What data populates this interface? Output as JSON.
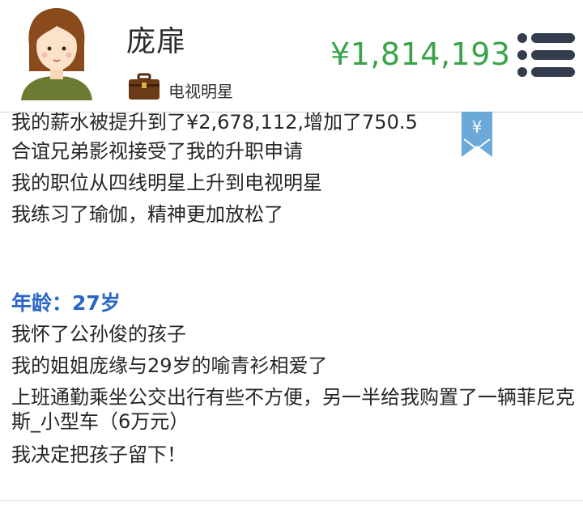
{
  "header": {
    "player_name": "庞扉",
    "job_title": "电视明星",
    "money": "¥1,814,193",
    "avatar_icon": "female-avatar-icon",
    "job_icon": "briefcase-icon",
    "menu_icon": "menu-icon",
    "bookmark_icon": "yen-bookmark-icon",
    "bookmark_symbol": "¥"
  },
  "log": {
    "lines_top": [
      "我的薪水被提升到了¥2,678,112,增加了750.5",
      "合谊兄弟影视接受了我的升职申请",
      "我的职位从四线明星上升到电视明星",
      "我练习了瑜伽，精神更加放松了"
    ],
    "age_label": "年龄：27岁",
    "lines_bottom": [
      "我怀了公孙俊的孩子",
      "我的姐姐庞缘与29岁的喻青衫相爱了",
      "上班通勤乘坐公交出行有些不方便，另一半给我购置了一辆菲尼克斯_小型车（6万元）",
      "我决定把孩子留下！"
    ]
  },
  "colors": {
    "money": "#3aa34a",
    "age_heading": "#2a66c8",
    "bookmark": "#6aa9d8",
    "menu": "#333d4d",
    "sweater": "#6b7c32",
    "hair": "#8a4a1c"
  }
}
